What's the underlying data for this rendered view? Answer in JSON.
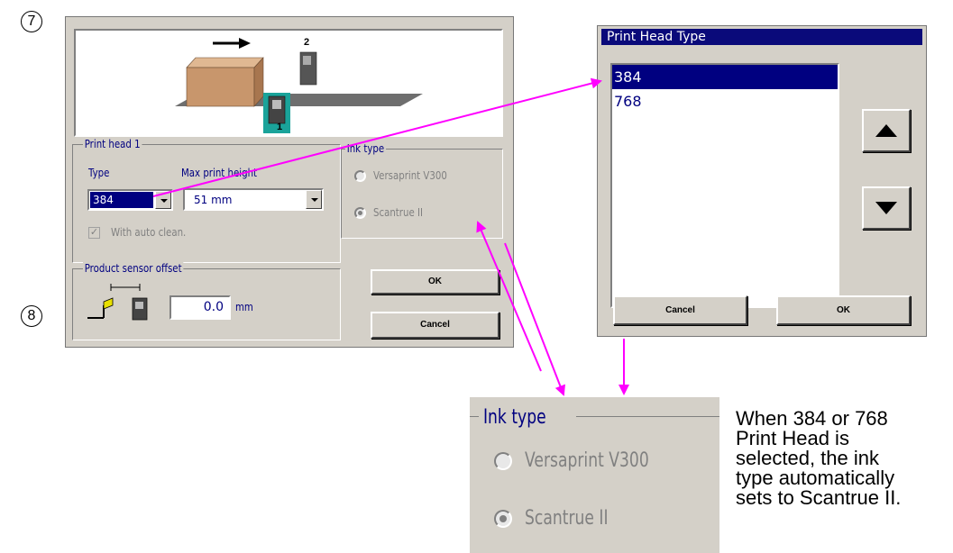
{
  "callouts": {
    "step7": "7",
    "step8": "8"
  },
  "main_dialog": {
    "diagram": {
      "head2_number": "2",
      "head1_number": "1"
    },
    "print_head_group": "Print head 1",
    "type_label": "Type",
    "type_value": "384",
    "max_height_label": "Max print height",
    "max_height_value": "51 mm",
    "auto_clean_label": "With auto clean.",
    "ink_type_group": "Ink type",
    "ink_options": [
      "Versaprint V300",
      "Scantrue II"
    ],
    "sensor_group": "Product sensor offset",
    "offset_value": "0.0",
    "offset_unit": "mm",
    "ok_label": "OK",
    "cancel_label": "Cancel"
  },
  "print_head_dialog": {
    "title": "Print Head Type",
    "options": [
      "384",
      "768"
    ],
    "selected": "384",
    "up_icon": "triangle-up",
    "down_icon": "triangle-down",
    "cancel_label": "Cancel",
    "ok_label": "OK"
  },
  "ink_zoom": {
    "group_label": "Ink type",
    "options": [
      "Versaprint V300",
      "Scantrue II"
    ]
  },
  "note_text": "When 384 or 768\nPrint Head is\nselected, the ink\ntype automatically\nsets to Scantrue II.",
  "colors": {
    "arrow": "#ff00ff",
    "title_bar": "#0a0a7a",
    "selection": "#000080",
    "label_blue": "#000080",
    "panel": "#d4d0c8"
  }
}
